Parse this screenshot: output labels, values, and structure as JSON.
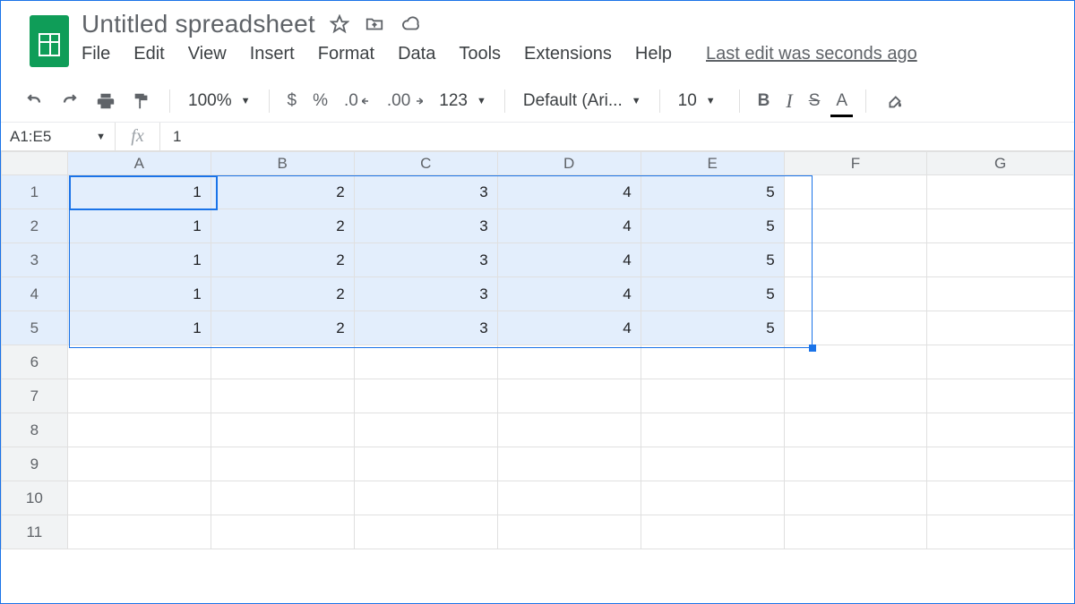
{
  "header": {
    "title": "Untitled spreadsheet",
    "last_edit": "Last edit was seconds ago"
  },
  "menus": {
    "file": "File",
    "edit": "Edit",
    "view": "View",
    "insert": "Insert",
    "format": "Format",
    "data": "Data",
    "tools": "Tools",
    "extensions": "Extensions",
    "help": "Help"
  },
  "toolbar": {
    "zoom": "100%",
    "currency": "$",
    "percent": "%",
    "dec_less": ".0",
    "dec_more": ".00",
    "more_formats": "123",
    "font": "Default (Ari...",
    "font_size": "10",
    "bold": "B",
    "italic": "I",
    "strike": "S",
    "text_color": "A"
  },
  "fx": {
    "name_box": "A1:E5",
    "label": "fx",
    "value": "1"
  },
  "columns": [
    "A",
    "B",
    "C",
    "D",
    "E",
    "F",
    "G"
  ],
  "rows": [
    "1",
    "2",
    "3",
    "4",
    "5",
    "6",
    "7",
    "8",
    "9",
    "10",
    "11"
  ],
  "cells": {
    "r1": {
      "A": "1",
      "B": "2",
      "C": "3",
      "D": "4",
      "E": "5"
    },
    "r2": {
      "A": "1",
      "B": "2",
      "C": "3",
      "D": "4",
      "E": "5"
    },
    "r3": {
      "A": "1",
      "B": "2",
      "C": "3",
      "D": "4",
      "E": "5"
    },
    "r4": {
      "A": "1",
      "B": "2",
      "C": "3",
      "D": "4",
      "E": "5"
    },
    "r5": {
      "A": "1",
      "B": "2",
      "C": "3",
      "D": "4",
      "E": "5"
    }
  },
  "selection": {
    "range": "A1:E5",
    "active": "A1"
  }
}
